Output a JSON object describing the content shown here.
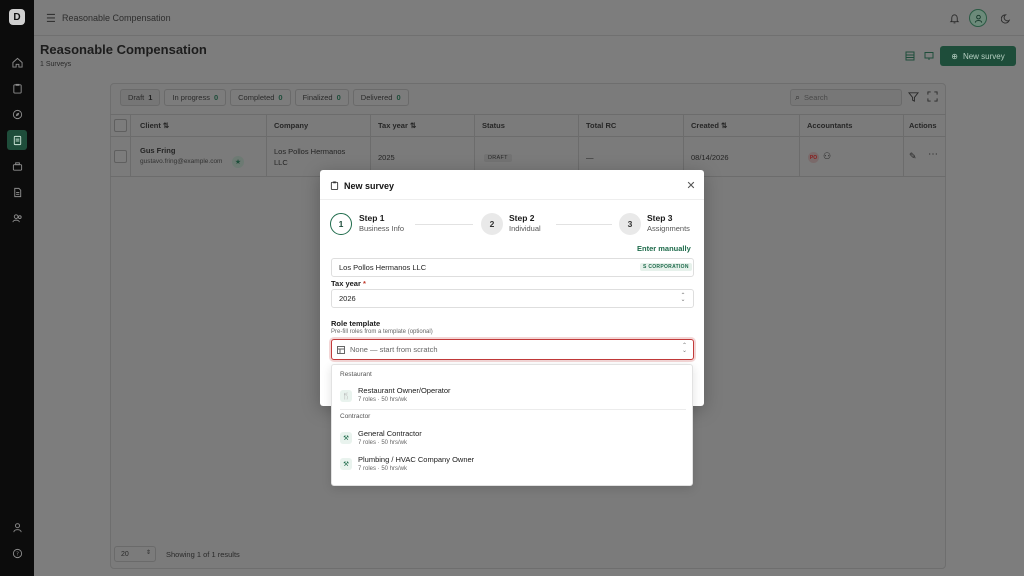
{
  "app": {
    "logo_text": "D",
    "breadcrumb": "Reasonable Compensation"
  },
  "header": {
    "title": "Reasonable Compensation",
    "subtitle": "1 Surveys",
    "new_survey_label": "New survey"
  },
  "filters": [
    {
      "label": "Draft",
      "count": "1"
    },
    {
      "label": "In progress",
      "count": "0"
    },
    {
      "label": "Completed",
      "count": "0"
    },
    {
      "label": "Finalized",
      "count": "0"
    },
    {
      "label": "Delivered",
      "count": "0"
    }
  ],
  "search": {
    "placeholder": "Search"
  },
  "table": {
    "headers": {
      "client": "Client",
      "company": "Company",
      "tax_year": "Tax year",
      "status": "Status",
      "total_rc": "Total RC",
      "created": "Created",
      "accountants": "Accountants",
      "actions": "Actions"
    },
    "rows": [
      {
        "client_name": "Gus Fring",
        "client_email": "gustavo.fring@example.com",
        "company_line1": "Los Pollos Hermanos",
        "company_line2": "LLC",
        "tax_year": "2025",
        "status": "DRAFT",
        "total_rc": "—",
        "created": "08/14/2026",
        "accountant_initials": "PO"
      }
    ]
  },
  "footer": {
    "page_size": "20",
    "showing": "Showing 1 of 1 results"
  },
  "modal": {
    "title": "New survey",
    "steps": [
      {
        "num": "1",
        "title": "Step 1",
        "sub": "Business Info"
      },
      {
        "num": "2",
        "title": "Step 2",
        "sub": "Individual"
      },
      {
        "num": "3",
        "title": "Step 3",
        "sub": "Assignments"
      }
    ],
    "enter_manually": "Enter manually",
    "company_value": "Los Pollos Hermanos LLC",
    "company_badge": "S CORPORATION",
    "tax_year_label": "Tax year",
    "tax_year_required": "*",
    "tax_year_value": "2026",
    "role_template_label": "Role template",
    "role_template_helper": "Pre-fill roles from a template (optional)",
    "role_template_placeholder": "None — start from scratch",
    "dropdown": {
      "groups": [
        {
          "name": "Restaurant",
          "options": [
            {
              "title": "Restaurant Owner/Operator",
              "sub": "7 roles · 50 hrs/wk"
            }
          ]
        },
        {
          "name": "Contractor",
          "options": [
            {
              "title": "General Contractor",
              "sub": "7 roles · 50 hrs/wk"
            },
            {
              "title": "Plumbing / HVAC Company Owner",
              "sub": "7 roles · 50 hrs/wk"
            }
          ]
        }
      ]
    }
  },
  "colors": {
    "brand": "#1e4d3a",
    "accent": "#1e6b4b",
    "error": "#c23a3a"
  }
}
